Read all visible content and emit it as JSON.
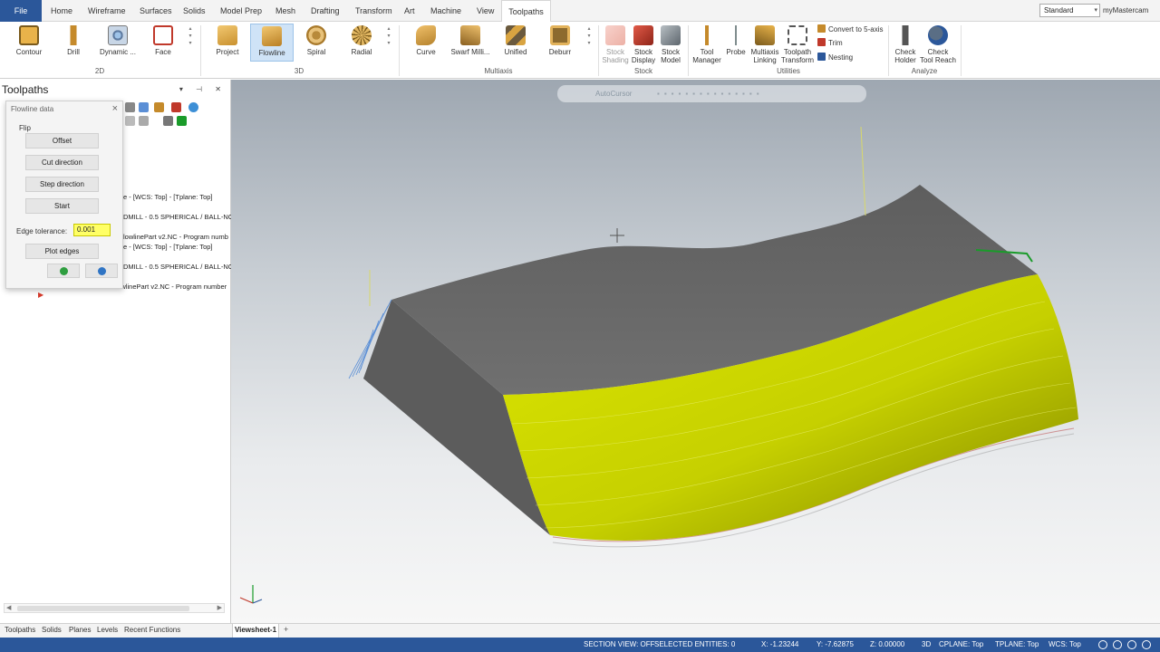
{
  "ribbon_tabs": {
    "file": "File",
    "tabs": [
      "Home",
      "Wireframe",
      "Surfaces",
      "Solids",
      "Model Prep",
      "Mesh",
      "Drafting",
      "Transform",
      "Art",
      "Machine",
      "View",
      "Toolpaths"
    ],
    "active": "Toolpaths",
    "config_select": "Standard",
    "account": "myMastercam"
  },
  "ribbon": {
    "buttons": [
      {
        "l1": "Contour",
        "l2": ""
      },
      {
        "l1": "Drill",
        "l2": ""
      },
      {
        "l1": "Dynamic ...",
        "l2": ""
      },
      {
        "l1": "Face",
        "l2": ""
      },
      {
        "l1": "Project",
        "l2": ""
      },
      {
        "l1": "Flowline",
        "l2": ""
      },
      {
        "l1": "Spiral",
        "l2": ""
      },
      {
        "l1": "Radial",
        "l2": ""
      },
      {
        "l1": "Curve",
        "l2": ""
      },
      {
        "l1": "Swarf Milli...",
        "l2": ""
      },
      {
        "l1": "Unified",
        "l2": ""
      },
      {
        "l1": "Deburr",
        "l2": ""
      },
      {
        "l1": "Stock",
        "l2": "Shading"
      },
      {
        "l1": "Stock",
        "l2": "Display"
      },
      {
        "l1": "Stock",
        "l2": "Model"
      },
      {
        "l1": "Tool",
        "l2": "Manager"
      },
      {
        "l1": "Probe",
        "l2": ""
      },
      {
        "l1": "Multiaxis",
        "l2": "Linking"
      },
      {
        "l1": "Toolpath",
        "l2": "Transform"
      },
      {
        "l1": "Check",
        "l2": "Holder"
      },
      {
        "l1": "Check",
        "l2": "Tool Reach"
      }
    ],
    "utilities_small": [
      "Convert to 5-axis",
      "Trim",
      "Nesting"
    ],
    "groups": [
      "2D",
      "3D",
      "Multiaxis",
      "Stock",
      "Utilities",
      "Analyze"
    ],
    "colors": {
      "selected": "#cfe3f7",
      "orange": "#d9a441",
      "red": "#c0392b",
      "gray": "#7f8c8d",
      "blue": "#2b579a"
    }
  },
  "manager": {
    "title": "Toolpaths",
    "tree": [
      "e - [WCS: Top] - [Tplane: Top]",
      "DMILL - 0.5 SPHERICAL / BALL-NC",
      "lowlinePart v2.NC - Program numb",
      "e - [WCS: Top] - [Tplane: Top]",
      "DMILL - 0.5 SPHERICAL / BALL-NC",
      "FlowlinePart v2.NC - Program number"
    ]
  },
  "dialog": {
    "title": "Flowline data",
    "flip_label": "Flip",
    "buttons": [
      "Offset",
      "Cut direction",
      "Step direction",
      "Start"
    ],
    "edge_tolerance_label": "Edge tolerance:",
    "edge_tolerance_value": "0.001",
    "plot_edges": "Plot edges"
  },
  "viewport": {
    "autocursor": "AutoCursor",
    "colors": {
      "top_face": "#6b6b6b",
      "side_face": "#5a5a5a",
      "yellow_face": "#c8d400",
      "toolpath": "#5b8fd6",
      "axis_green": "#1a9b2a"
    }
  },
  "bottom_tabs": {
    "tabs": [
      "Toolpaths",
      "Solids",
      "Planes",
      "Levels",
      "Recent Functions"
    ],
    "viewsheet": "Viewsheet-1",
    "plus": "+"
  },
  "status": {
    "section_view": "SECTION VIEW: OFF",
    "selected": "SELECTED ENTITIES: 0",
    "x": "X:   -1.23244",
    "y": "Y:   -7.62875",
    "z": "Z:   0.00000",
    "mode": "3D",
    "cplane": "CPLANE: Top",
    "tplane": "TPLANE: Top",
    "wcs": "WCS: Top"
  }
}
